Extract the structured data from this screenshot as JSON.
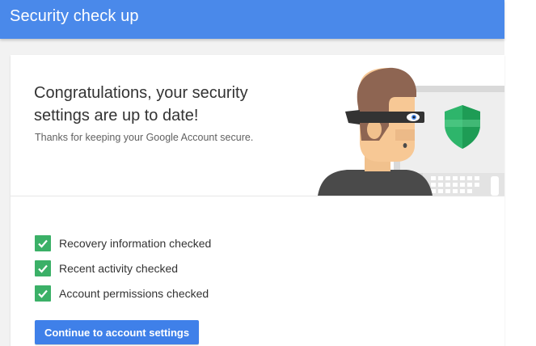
{
  "app_bar": {
    "title": "Security check up"
  },
  "hero": {
    "headline": "Congratulations, your security settings are up to date!",
    "subtext": "Thanks for keeping your Google Account secure.",
    "illustration": {
      "character_icon": "masked-person-icon",
      "screen_icon": "shield-icon",
      "shield_color": "#2eb56b"
    }
  },
  "checklist": {
    "items": [
      {
        "icon": "check-icon",
        "label": "Recovery information checked"
      },
      {
        "icon": "check-icon",
        "label": "Recent activity checked"
      },
      {
        "icon": "check-icon",
        "label": "Account permissions checked"
      }
    ]
  },
  "actions": {
    "continue_label": "Continue to account settings"
  },
  "colors": {
    "app_bar": "#4a89ea",
    "check": "#3bb067",
    "button": "#3f80e9"
  }
}
